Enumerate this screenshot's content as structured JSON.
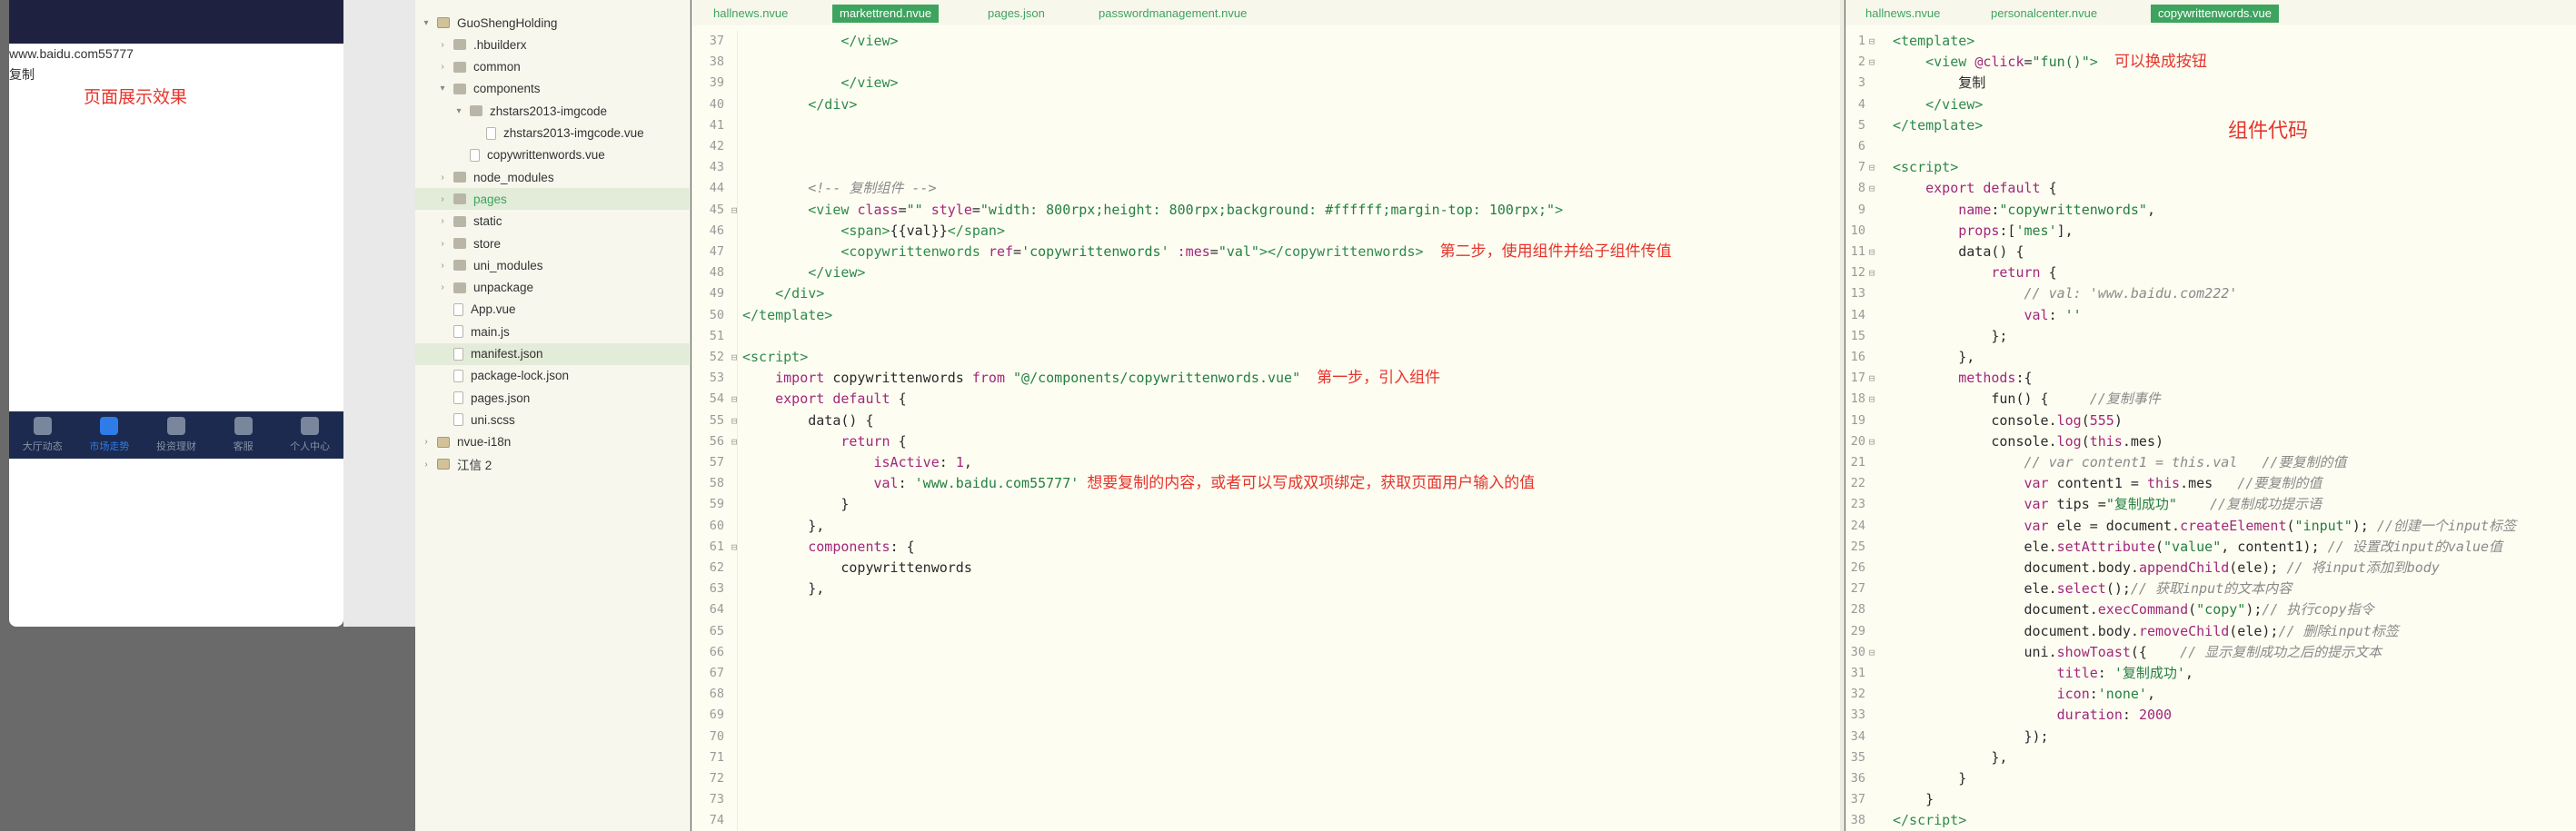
{
  "phone": {
    "url_text": "www.baidu.com55777",
    "copy_text": "复制",
    "annotation": "页面展示效果",
    "tabs": [
      {
        "label": "大厅动态",
        "icon": "home-icon",
        "active": false
      },
      {
        "label": "市场走势",
        "icon": "chart-icon",
        "active": true
      },
      {
        "label": "投资理财",
        "icon": "wallet-icon",
        "active": false
      },
      {
        "label": "客服",
        "icon": "headset-icon",
        "active": false
      },
      {
        "label": "个人中心",
        "icon": "user-icon",
        "active": false
      }
    ]
  },
  "filetree": {
    "items": [
      {
        "label": "GuoShengHolding",
        "indent": 0,
        "arrow": "▾",
        "icon": "project",
        "selected": false,
        "green": false
      },
      {
        "label": ".hbuilderx",
        "indent": 1,
        "arrow": "›",
        "icon": "folder",
        "selected": false,
        "green": false
      },
      {
        "label": "common",
        "indent": 1,
        "arrow": "›",
        "icon": "folder",
        "selected": false,
        "green": false
      },
      {
        "label": "components",
        "indent": 1,
        "arrow": "▾",
        "icon": "folder",
        "selected": false,
        "green": false
      },
      {
        "label": "zhstars2013-imgcode",
        "indent": 2,
        "arrow": "▾",
        "icon": "folder",
        "selected": false,
        "green": false
      },
      {
        "label": "zhstars2013-imgcode.vue",
        "indent": 3,
        "arrow": "",
        "icon": "file",
        "selected": false,
        "green": false
      },
      {
        "label": "copywrittenwords.vue",
        "indent": 2,
        "arrow": "",
        "icon": "file",
        "selected": false,
        "green": false
      },
      {
        "label": "node_modules",
        "indent": 1,
        "arrow": "›",
        "icon": "folder",
        "selected": false,
        "green": false
      },
      {
        "label": "pages",
        "indent": 1,
        "arrow": "›",
        "icon": "folder",
        "selected": true,
        "green": true
      },
      {
        "label": "static",
        "indent": 1,
        "arrow": "›",
        "icon": "folder",
        "selected": false,
        "green": false
      },
      {
        "label": "store",
        "indent": 1,
        "arrow": "›",
        "icon": "folder",
        "selected": false,
        "green": false
      },
      {
        "label": "uni_modules",
        "indent": 1,
        "arrow": "›",
        "icon": "folder",
        "selected": false,
        "green": false
      },
      {
        "label": "unpackage",
        "indent": 1,
        "arrow": "›",
        "icon": "folder",
        "selected": false,
        "green": false
      },
      {
        "label": "App.vue",
        "indent": 1,
        "arrow": "",
        "icon": "file",
        "selected": false,
        "green": false
      },
      {
        "label": "main.js",
        "indent": 1,
        "arrow": "",
        "icon": "file",
        "selected": false,
        "green": false
      },
      {
        "label": "manifest.json",
        "indent": 1,
        "arrow": "",
        "icon": "file",
        "selected": true,
        "green": false
      },
      {
        "label": "package-lock.json",
        "indent": 1,
        "arrow": "",
        "icon": "file",
        "selected": false,
        "green": false
      },
      {
        "label": "pages.json",
        "indent": 1,
        "arrow": "",
        "icon": "file",
        "selected": false,
        "green": false
      },
      {
        "label": "uni.scss",
        "indent": 1,
        "arrow": "",
        "icon": "file",
        "selected": false,
        "green": false
      },
      {
        "label": "nvue-i18n",
        "indent": 0,
        "arrow": "›",
        "icon": "project",
        "selected": false,
        "green": false
      },
      {
        "label": "江信 2",
        "indent": 0,
        "arrow": "›",
        "icon": "project",
        "selected": false,
        "green": false
      }
    ]
  },
  "editor_left": {
    "tabs": [
      {
        "label": "hallnews.nvue",
        "active": false
      },
      {
        "label": "markettrend.nvue",
        "active": true
      },
      {
        "label": "pages.json",
        "active": false
      },
      {
        "label": "passwordmanagement.nvue",
        "active": false
      }
    ],
    "lines": [
      {
        "n": "37",
        "fold": "",
        "html": "            <span class=\"tg\">&lt;/view&gt;</span>"
      },
      {
        "n": "38",
        "fold": "",
        "html": ""
      },
      {
        "n": "39",
        "fold": "",
        "html": "            <span class=\"tg\">&lt;/view&gt;</span>"
      },
      {
        "n": "40",
        "fold": "",
        "html": "        <span class=\"tg\">&lt;/div&gt;</span>"
      },
      {
        "n": "41",
        "fold": "",
        "html": ""
      },
      {
        "n": "42",
        "fold": "",
        "html": ""
      },
      {
        "n": "43",
        "fold": "",
        "html": ""
      },
      {
        "n": "44",
        "fold": "",
        "html": "        <span class=\"cm\">&lt;!-- 复制组件 --&gt;</span>"
      },
      {
        "n": "45",
        "fold": "⊟",
        "html": "        <span class=\"tg\">&lt;view</span> <span class=\"at\">class</span>=<span class=\"st\">\"\"</span> <span class=\"at\">style</span>=<span class=\"st\">\"width: 800rpx;height: 800rpx;background: #ffffff;margin-top: 100rpx;\"</span><span class=\"tg\">&gt;</span>"
      },
      {
        "n": "46",
        "fold": "",
        "html": "            <span class=\"tg\">&lt;span&gt;</span>{{val}}<span class=\"tg\">&lt;/span&gt;</span>"
      },
      {
        "n": "47",
        "fold": "",
        "html": "            <span class=\"tg\">&lt;copywrittenwords</span> <span class=\"at\">ref</span>=<span class=\"st\">'copywrittenwords'</span> <span class=\"at\">:mes</span>=<span class=\"st\">\"val\"</span><span class=\"tg\">&gt;&lt;/copywrittenwords&gt;</span>  <span class=\"red\">第二步，使用组件并给子组件传值</span>"
      },
      {
        "n": "48",
        "fold": "",
        "html": "        <span class=\"tg\">&lt;/view&gt;</span>"
      },
      {
        "n": "49",
        "fold": "",
        "html": "    <span class=\"tg\">&lt;/div&gt;</span>"
      },
      {
        "n": "50",
        "fold": "",
        "html": "<span class=\"tg\">&lt;/template&gt;</span>"
      },
      {
        "n": "51",
        "fold": "",
        "html": ""
      },
      {
        "n": "52",
        "fold": "⊟",
        "html": "<span class=\"tg\">&lt;script&gt;</span>"
      },
      {
        "n": "53",
        "fold": "",
        "html": "    <span class=\"kw\">import</span> copywrittenwords <span class=\"kw\">from</span> <span class=\"st\">\"@/components/copywrittenwords.vue\"</span>  <span class=\"red\">第一步，引入组件</span>"
      },
      {
        "n": "54",
        "fold": "⊟",
        "html": "    <span class=\"kw\">export default</span> {"
      },
      {
        "n": "55",
        "fold": "⊟",
        "html": "        data() {"
      },
      {
        "n": "56",
        "fold": "⊟",
        "html": "            <span class=\"kw\">return</span> {"
      },
      {
        "n": "57",
        "fold": "",
        "html": "                <span class=\"at\">isActive</span>: <span class=\"nm\">1</span>,"
      },
      {
        "n": "58",
        "fold": "",
        "html": "                <span class=\"at\">val</span>: <span class=\"st\">'www.baidu.com55777'</span> <span class=\"red\">想要复制的内容，或者可以写成双项绑定，获取页面用户输入的值</span>"
      },
      {
        "n": "59",
        "fold": "",
        "html": "            }"
      },
      {
        "n": "60",
        "fold": "",
        "html": "        },"
      },
      {
        "n": "61",
        "fold": "⊟",
        "html": "        <span class=\"at\">components</span>: {"
      },
      {
        "n": "62",
        "fold": "",
        "html": "            copywrittenwords"
      },
      {
        "n": "63",
        "fold": "",
        "html": "        },"
      },
      {
        "n": "64",
        "fold": "",
        "html": ""
      },
      {
        "n": "65",
        "fold": "",
        "html": ""
      },
      {
        "n": "66",
        "fold": "",
        "html": ""
      },
      {
        "n": "67",
        "fold": "",
        "html": ""
      },
      {
        "n": "68",
        "fold": "",
        "html": ""
      },
      {
        "n": "69",
        "fold": "",
        "html": ""
      },
      {
        "n": "70",
        "fold": "",
        "html": ""
      },
      {
        "n": "71",
        "fold": "",
        "html": ""
      },
      {
        "n": "72",
        "fold": "",
        "html": ""
      },
      {
        "n": "73",
        "fold": "",
        "html": ""
      },
      {
        "n": "74",
        "fold": "",
        "html": ""
      }
    ]
  },
  "editor_right": {
    "tabs": [
      {
        "label": "hallnews.nvue",
        "active": false
      },
      {
        "label": "personalcenter.nvue",
        "active": false
      },
      {
        "label": "copywrittenwords.vue",
        "active": true
      }
    ],
    "annotation": "组件代码",
    "lines": [
      {
        "n": "1",
        "fold": "⊟",
        "html": "<span class=\"tg\">&lt;template&gt;</span>"
      },
      {
        "n": "2",
        "fold": "⊟",
        "html": "    <span class=\"tg\">&lt;view</span> <span class=\"at\">@click</span>=<span class=\"st\">\"fun()\"</span><span class=\"tg\">&gt;</span>  <span class=\"red\">可以换成按钮</span>"
      },
      {
        "n": "3",
        "fold": "",
        "html": "        复制"
      },
      {
        "n": "4",
        "fold": "",
        "html": "    <span class=\"tg\">&lt;/view&gt;</span>"
      },
      {
        "n": "5",
        "fold": "",
        "html": "<span class=\"tg\">&lt;/template&gt;</span>"
      },
      {
        "n": "6",
        "fold": "",
        "html": ""
      },
      {
        "n": "7",
        "fold": "⊟",
        "html": "<span class=\"tg\">&lt;script&gt;</span>"
      },
      {
        "n": "8",
        "fold": "⊟",
        "html": "    <span class=\"kw\">export default</span> {"
      },
      {
        "n": "9",
        "fold": "",
        "html": "        <span class=\"at\">name</span>:<span class=\"st\">\"copywrittenwords\"</span>,"
      },
      {
        "n": "10",
        "fold": "",
        "html": "        <span class=\"at\">props</span>:[<span class=\"st\">'mes'</span>],"
      },
      {
        "n": "11",
        "fold": "⊟",
        "html": "        data() {"
      },
      {
        "n": "12",
        "fold": "⊟",
        "html": "            <span class=\"kw\">return</span> {"
      },
      {
        "n": "13",
        "fold": "",
        "html": "                <span class=\"cm\">// val: 'www.baidu.com222'</span>"
      },
      {
        "n": "14",
        "fold": "",
        "html": "                <span class=\"at\">val</span>: <span class=\"st\">''</span>"
      },
      {
        "n": "15",
        "fold": "",
        "html": "            };"
      },
      {
        "n": "16",
        "fold": "",
        "html": "        },"
      },
      {
        "n": "17",
        "fold": "⊟",
        "html": "        <span class=\"at\">methods</span>:{"
      },
      {
        "n": "18",
        "fold": "⊟",
        "html": "            fun() {     <span class=\"cm\">//复制事件</span>"
      },
      {
        "n": "19",
        "fold": "",
        "html": "            console.<span class=\"at\">log</span>(<span class=\"nm\">555</span>)"
      },
      {
        "n": "20",
        "fold": "⊟",
        "html": "            console.<span class=\"at\">log</span>(<span class=\"kw\">this</span>.mes)"
      },
      {
        "n": "21",
        "fold": "",
        "html": "                <span class=\"cm\">// var content1 = this.val   //要复制的值</span>"
      },
      {
        "n": "22",
        "fold": "",
        "html": "                <span class=\"kw\">var</span> content1 = <span class=\"kw\">this</span>.mes   <span class=\"cm\">//要复制的值</span>"
      },
      {
        "n": "23",
        "fold": "",
        "html": "                <span class=\"kw\">var</span> tips =<span class=\"st\">\"复制成功\"</span>    <span class=\"cm\">//复制成功提示语</span>"
      },
      {
        "n": "24",
        "fold": "",
        "html": "                <span class=\"kw\">var</span> ele = document.<span class=\"at\">createElement</span>(<span class=\"st\">\"input\"</span>); <span class=\"cm\">//创建一个input标签</span>"
      },
      {
        "n": "25",
        "fold": "",
        "html": "                ele.<span class=\"at\">setAttribute</span>(<span class=\"st\">\"value\"</span>, content1); <span class=\"cm\">// 设置改input的value值</span>"
      },
      {
        "n": "26",
        "fold": "",
        "html": "                document.body.<span class=\"at\">appendChild</span>(ele); <span class=\"cm\">// 将input添加到body</span>"
      },
      {
        "n": "27",
        "fold": "",
        "html": "                ele.<span class=\"at\">select</span>();<span class=\"cm\">// 获取input的文本内容</span>"
      },
      {
        "n": "28",
        "fold": "",
        "html": "                document.<span class=\"at\">execCommand</span>(<span class=\"st\">\"copy\"</span>);<span class=\"cm\">// 执行copy指令</span>"
      },
      {
        "n": "29",
        "fold": "",
        "html": "                document.body.<span class=\"at\">removeChild</span>(ele);<span class=\"cm\">// 删除input标签</span>"
      },
      {
        "n": "30",
        "fold": "⊟",
        "html": "                uni.<span class=\"at\">showToast</span>({    <span class=\"cm\">// 显示复制成功之后的提示文本</span>"
      },
      {
        "n": "31",
        "fold": "",
        "html": "                    <span class=\"at\">title</span>: <span class=\"st\">'复制成功'</span>,"
      },
      {
        "n": "32",
        "fold": "",
        "html": "                    <span class=\"at\">icon</span>:<span class=\"st\">'none'</span>,"
      },
      {
        "n": "33",
        "fold": "",
        "html": "                    <span class=\"at\">duration</span>: <span class=\"nm\">2000</span>"
      },
      {
        "n": "34",
        "fold": "",
        "html": "                });"
      },
      {
        "n": "35",
        "fold": "",
        "html": "            },"
      },
      {
        "n": "36",
        "fold": "",
        "html": "        }"
      },
      {
        "n": "37",
        "fold": "",
        "html": "    }"
      },
      {
        "n": "38",
        "fold": "",
        "html": "<span class=\"tg\">&lt;/script&gt;</span>"
      }
    ]
  }
}
